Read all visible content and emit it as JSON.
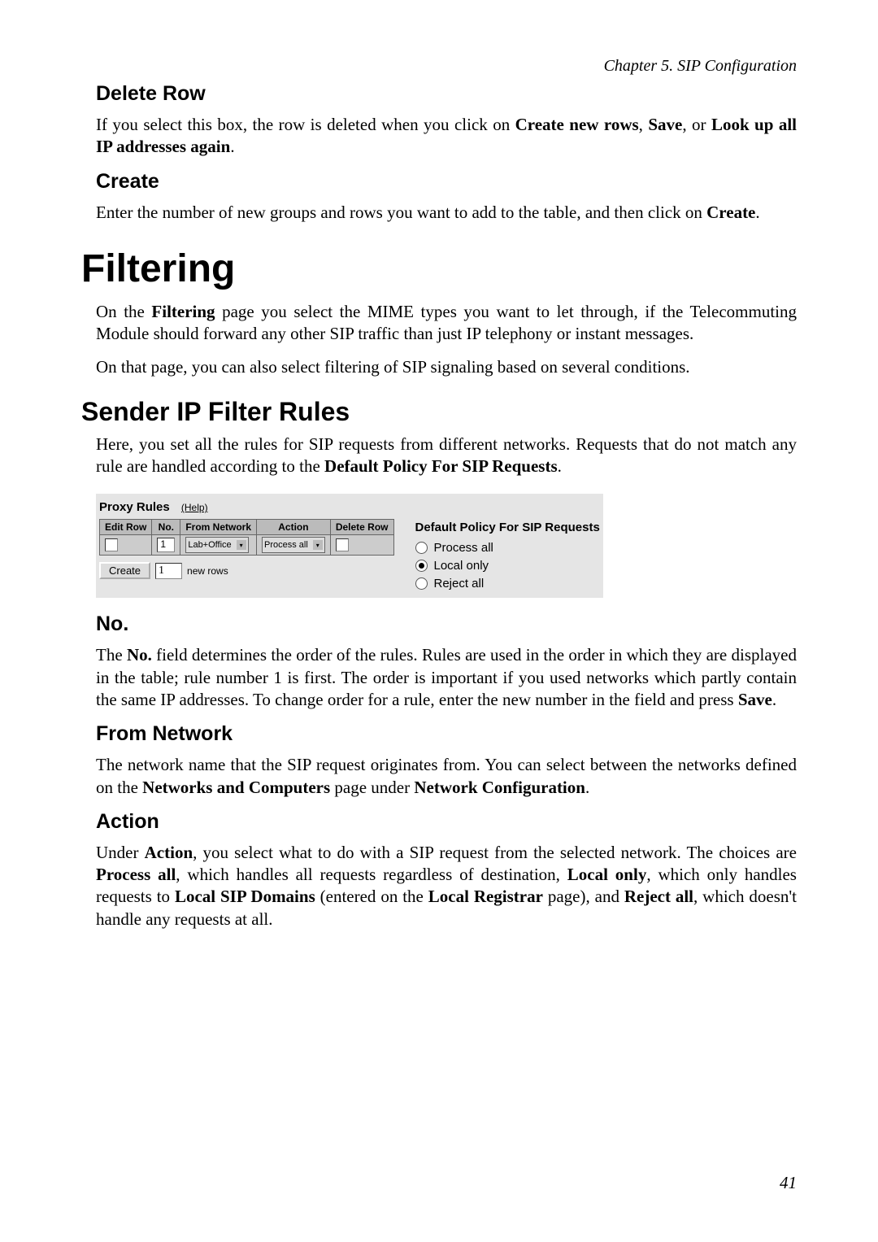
{
  "chapter_header": "Chapter 5. SIP Configuration",
  "delete_row": {
    "heading": "Delete Row",
    "text_1": "If you select this box, the row is deleted when you click on ",
    "bold_1": "Create new rows",
    "sep_1": ", ",
    "bold_2": "Save",
    "sep_2": ", or ",
    "bold_3": "Look up all IP addresses again",
    "tail": "."
  },
  "create": {
    "heading": "Create",
    "text_1": "Enter the number of new groups and rows you want to add to the table, and then click on ",
    "bold_1": "Create",
    "tail": "."
  },
  "filtering": {
    "heading": "Filtering",
    "para1_a": "On the ",
    "para1_b_bold": "Filtering",
    "para1_c": " page you select the MIME types you want to let through, if the Telecommuting Module should forward any other SIP traffic than just IP telephony or instant messages.",
    "para2": "On that page, you can also select filtering of SIP signaling based on several conditions."
  },
  "sender_rules": {
    "heading": "Sender IP Filter Rules",
    "para_a": "Here, you set all the rules for SIP requests from different networks. Requests that do not match any rule are handled according to the ",
    "para_bold": "Default Policy For SIP Requests",
    "para_tail": "."
  },
  "widget": {
    "title": "Proxy Rules",
    "help": "(Help)",
    "cols": {
      "edit": "Edit Row",
      "no": "No.",
      "from": "From Network",
      "action": "Action",
      "delete": "Delete Row"
    },
    "row": {
      "no": "1",
      "from": "Lab+Office",
      "action": "Process all"
    },
    "create_btn": "Create",
    "create_value": "1",
    "new_rows": "new rows",
    "default_policy_title": "Default Policy For SIP Requests",
    "radios": {
      "process_all": "Process all",
      "local_only": "Local only",
      "reject_all": "Reject all"
    }
  },
  "no_section": {
    "heading": "No.",
    "t1": "The ",
    "b1": "No.",
    "t2": " field determines the order of the rules. Rules are used in the order in which they are displayed in the table; rule number 1 is first. The order is important if you used networks which partly contain the same IP addresses. To change order for a rule, enter the new number in the field and press ",
    "b2": "Save",
    "t3": "."
  },
  "from_network": {
    "heading": "From Network",
    "t1": "The network name that the SIP request originates from. You can select between the networks defined on the ",
    "b1": "Networks and Computers",
    "t2": " page under ",
    "b2": "Network Configuration",
    "t3": "."
  },
  "action_section": {
    "heading": "Action",
    "t1": "Under ",
    "b1": "Action",
    "t2": ", you select what to do with a SIP request from the selected network. The choices are ",
    "b2": "Process all",
    "t3": ", which handles all requests regardless of destination, ",
    "b3": "Local only",
    "t4": ", which only handles requests to ",
    "b4": "Local SIP Domains",
    "t5": " (entered on the ",
    "b5": "Local Registrar",
    "t6": " page), and ",
    "b6": "Reject all",
    "t7": ", which doesn't handle any requests at all."
  },
  "page_number": "41"
}
